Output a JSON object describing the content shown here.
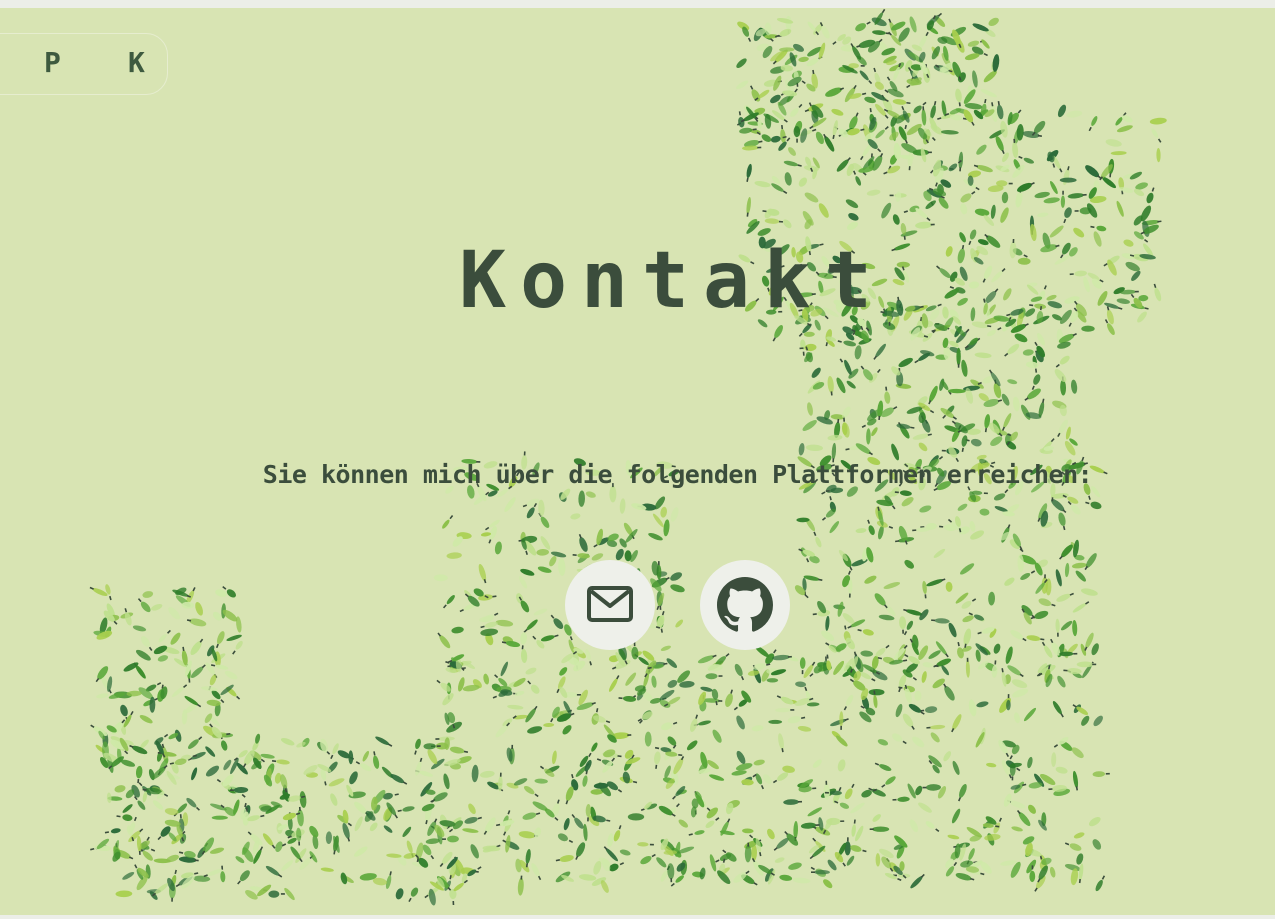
{
  "nav": {
    "items": [
      {
        "label": "P"
      },
      {
        "label": "K"
      }
    ]
  },
  "page": {
    "title": "Kontakt",
    "subtitle": "Sie können mich über die folgenden Plattformen erreichen:"
  },
  "social": [
    {
      "name": "email",
      "icon": "mail-icon"
    },
    {
      "name": "github",
      "icon": "github-icon"
    }
  ],
  "colors": {
    "background": "#d8e4b3",
    "text": "#3b4d3c",
    "leaf_dark": "#3f8f2e",
    "leaf_mid": "#8cc04a",
    "leaf_light": "#bfe08e",
    "button_bg": "#eef0ea"
  }
}
